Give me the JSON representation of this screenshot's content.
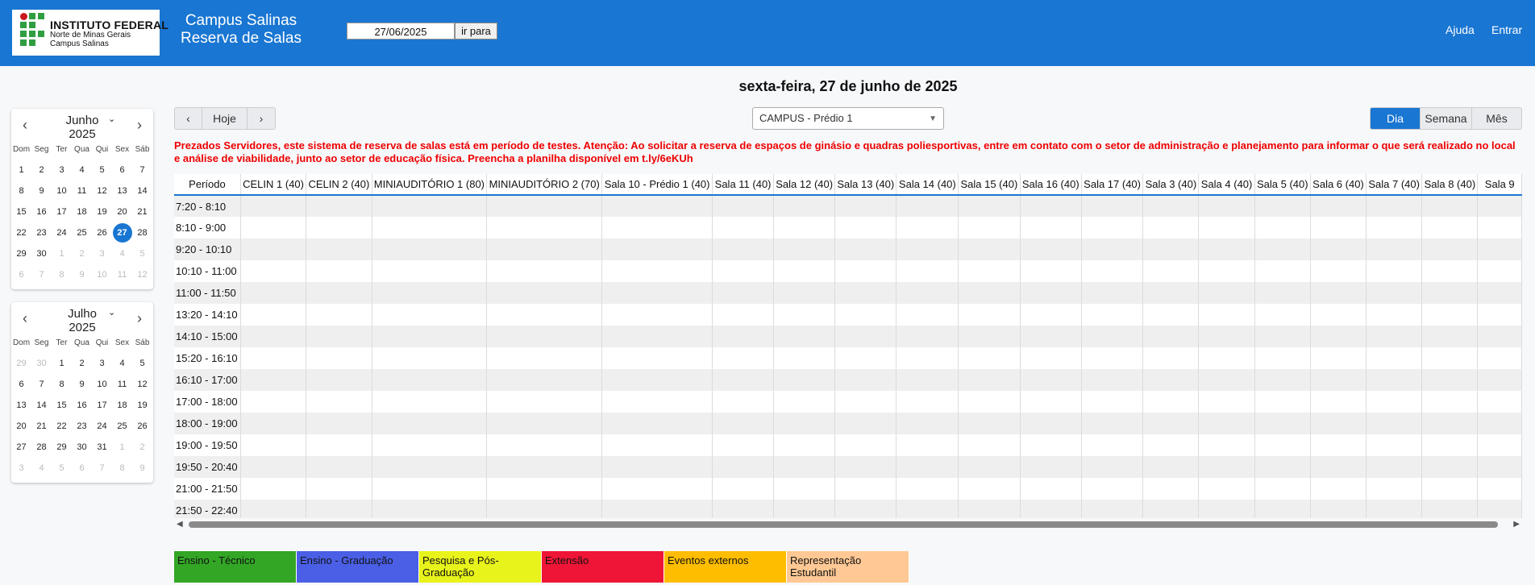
{
  "header": {
    "logo": {
      "line1": "INSTITUTO FEDERAL",
      "line2": "Norte de Minas Gerais",
      "line3": "Campus Salinas"
    },
    "title_line1": "Campus Salinas",
    "title_line2": "Reserva de Salas",
    "date_value": "27/06/2025",
    "go_label": "ir para",
    "help_label": "Ajuda",
    "login_label": "Entrar"
  },
  "day_heading": "sexta-feira, 27 de junho de 2025",
  "calendars": [
    {
      "month": "Junho",
      "year": "2025",
      "weekdays": [
        "Dom",
        "Seg",
        "Ter",
        "Qua",
        "Qui",
        "Sex",
        "Sáb"
      ],
      "days": [
        [
          "1",
          "2",
          "3",
          "4",
          "5",
          "6",
          "7"
        ],
        [
          "8",
          "9",
          "10",
          "11",
          "12",
          "13",
          "14"
        ],
        [
          "15",
          "16",
          "17",
          "18",
          "19",
          "20",
          "21"
        ],
        [
          "22",
          "23",
          "24",
          "25",
          "26",
          "27",
          "28"
        ],
        [
          "29",
          "30",
          "1",
          "2",
          "3",
          "4",
          "5"
        ],
        [
          "6",
          "7",
          "8",
          "9",
          "10",
          "11",
          "12"
        ]
      ],
      "selected": "27"
    },
    {
      "month": "Julho",
      "year": "2025",
      "weekdays": [
        "Dom",
        "Seg",
        "Ter",
        "Qua",
        "Qui",
        "Sex",
        "Sáb"
      ],
      "days": [
        [
          "29",
          "30",
          "1",
          "2",
          "3",
          "4",
          "5"
        ],
        [
          "6",
          "7",
          "8",
          "9",
          "10",
          "11",
          "12"
        ],
        [
          "13",
          "14",
          "15",
          "16",
          "17",
          "18",
          "19"
        ],
        [
          "20",
          "21",
          "22",
          "23",
          "24",
          "25",
          "26"
        ],
        [
          "27",
          "28",
          "29",
          "30",
          "31",
          "1",
          "2"
        ],
        [
          "3",
          "4",
          "5",
          "6",
          "7",
          "8",
          "9"
        ]
      ],
      "selected": ""
    }
  ],
  "toolbar": {
    "prev_label": "‹",
    "today_label": "Hoje",
    "next_label": "›",
    "building_select": "CAMPUS - Prédio 1",
    "view_day": "Dia",
    "view_week": "Semana",
    "view_month": "Mês",
    "active_view": "Dia"
  },
  "notice": "Prezados Servidores, este sistema de reserva de salas está em período de testes. Atenção: Ao solicitar a reserva de espaços de ginásio e quadras poliesportivas, entre em contato com o setor de administração e planejamento para informar o que será realizado no local e análise de viabilidade, junto ao setor de educação física. Preencha a planilha disponível em t.ly/6eKUh",
  "schedule": {
    "period_header": "Período",
    "rooms": [
      "CELIN 1 (40)",
      "CELIN 2 (40)",
      "MINIAUDITÓRIO 1 (80)",
      "MINIAUDITÓRIO 2 (70)",
      "Sala 10 - Prédio 1 (40)",
      "Sala 11 (40)",
      "Sala 12 (40)",
      "Sala 13 (40)",
      "Sala 14 (40)",
      "Sala 15 (40)",
      "Sala 16 (40)",
      "Sala 17 (40)",
      "Sala 3 (40)",
      "Sala 4 (40)",
      "Sala 5 (40)",
      "Sala 6 (40)",
      "Sala 7 (40)",
      "Sala 8 (40)",
      "Sala 9"
    ],
    "periods": [
      "7:20 - 8:10",
      "8:10 - 9:00",
      "9:20 - 10:10",
      "10:10 - 11:00",
      "11:00 - 11:50",
      "13:20 - 14:10",
      "14:10 - 15:00",
      "15:20 - 16:10",
      "16:10 - 17:00",
      "17:00 - 18:00",
      "18:00 - 19:00",
      "19:00 - 19:50",
      "19:50 - 20:40",
      "21:00 - 21:50",
      "21:50 - 22:40"
    ]
  },
  "legend": [
    {
      "label": "Ensino - Técnico",
      "color": "#33a626"
    },
    {
      "label": "Ensino - Graduação",
      "color": "#4a5fe6"
    },
    {
      "label": "Pesquisa e Pós-Graduação",
      "color": "#e8f31b"
    },
    {
      "label": "Extensão",
      "color": "#ef1536"
    },
    {
      "label": "Eventos externos",
      "color": "#ffbd00"
    },
    {
      "label": "Representação Estudantil",
      "color": "#ffc894"
    }
  ],
  "icons": [
    "chevron-left-icon",
    "chevron-right-icon",
    "chevron-down-icon",
    "caret-down-icon"
  ]
}
